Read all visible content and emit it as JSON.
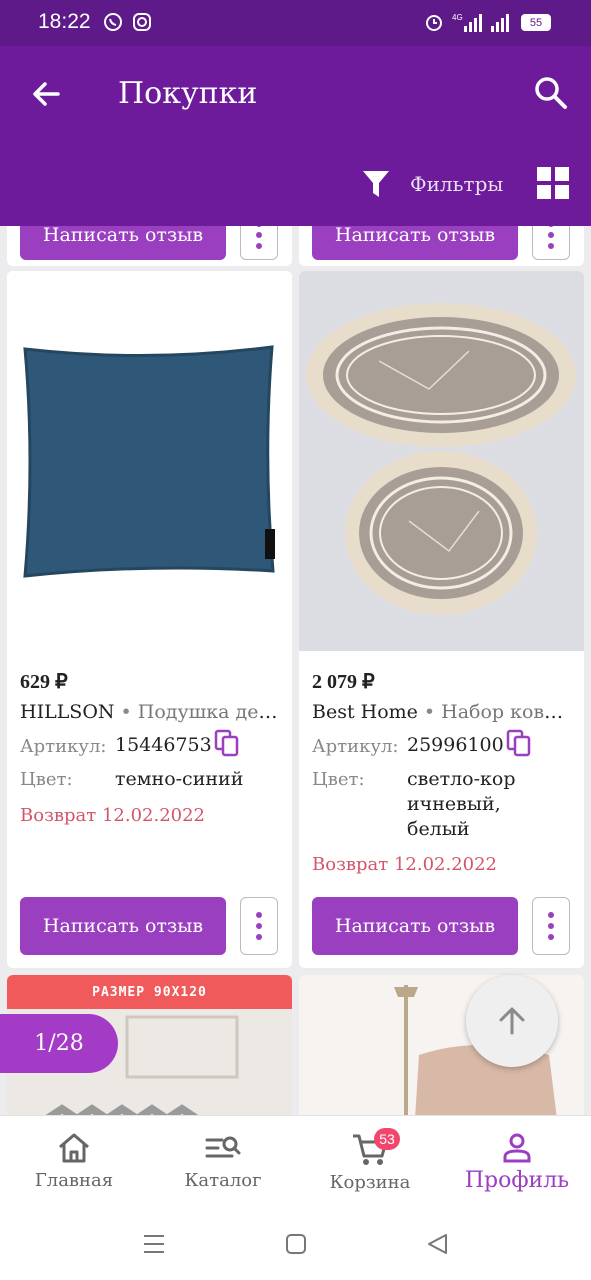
{
  "status_bar": {
    "time": "18:22",
    "battery": "55",
    "network": "4G"
  },
  "app_bar": {
    "title": "Покупки",
    "filters_label": "Фильтры"
  },
  "top_row": {
    "review_label": "Написать отзыв"
  },
  "products": [
    {
      "price": "629 ₽",
      "brand": "HILLSON",
      "name": "Подушка декоративная",
      "article_label": "Артикул:",
      "article": "15446753",
      "color_label": "Цвет:",
      "color": "темно-синий",
      "return": "Возврат 12.02.2022",
      "review_label": "Написать отзыв"
    },
    {
      "price": "2 079 ₽",
      "brand": "Best Home",
      "name": "Набор ковриков",
      "article_label": "Артикул:",
      "article": "25996100",
      "color_label": "Цвет:",
      "color_lines": [
        "светло-кор",
        "ичневый,",
        "белый"
      ],
      "return": "Возврат 12.02.2022",
      "review_label": "Написать отзыв"
    }
  ],
  "partial_banner": {
    "text": "РАЗМЕР 90Х120"
  },
  "pager": {
    "text": "1/28"
  },
  "tabs": [
    {
      "label": "Главная",
      "icon": "home-icon"
    },
    {
      "label": "Каталог",
      "icon": "catalog-search-icon"
    },
    {
      "label": "Корзина",
      "icon": "cart-icon",
      "badge": "53"
    },
    {
      "label": "Профиль",
      "icon": "profile-icon",
      "active": true
    }
  ],
  "colors": {
    "primary": "#6d1b9b",
    "accent": "#9b3fc1",
    "return": "#d3556a",
    "badge": "#f2476d"
  }
}
